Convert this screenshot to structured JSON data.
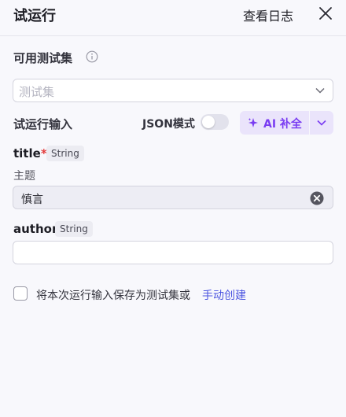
{
  "header": {
    "title": "试运行",
    "view_logs_label": "查看日志",
    "close_icon": "close-icon"
  },
  "test_set": {
    "label": "可用测试集",
    "info_icon": "info-icon",
    "placeholder": "测试集",
    "chevron_icon": "chevron-down-icon"
  },
  "run_input": {
    "label": "试运行输入",
    "json_mode_label": "JSON模式",
    "json_mode_on": false,
    "ai_button_label": "AI 补全",
    "ai_icon": "sparkle-icon",
    "ai_dropdown_icon": "chevron-down-icon",
    "accent_color": "#7a3df2"
  },
  "fields": {
    "title": {
      "name": "title",
      "required_mark": "*",
      "type": "String",
      "description": "主题",
      "value": "慎言"
    },
    "author": {
      "name": "author",
      "type": "String",
      "value": ""
    }
  },
  "save": {
    "checked": false,
    "text": "将本次运行输入保存为测试集或",
    "link_text": "手动创建",
    "link_color": "#4c55e0"
  }
}
